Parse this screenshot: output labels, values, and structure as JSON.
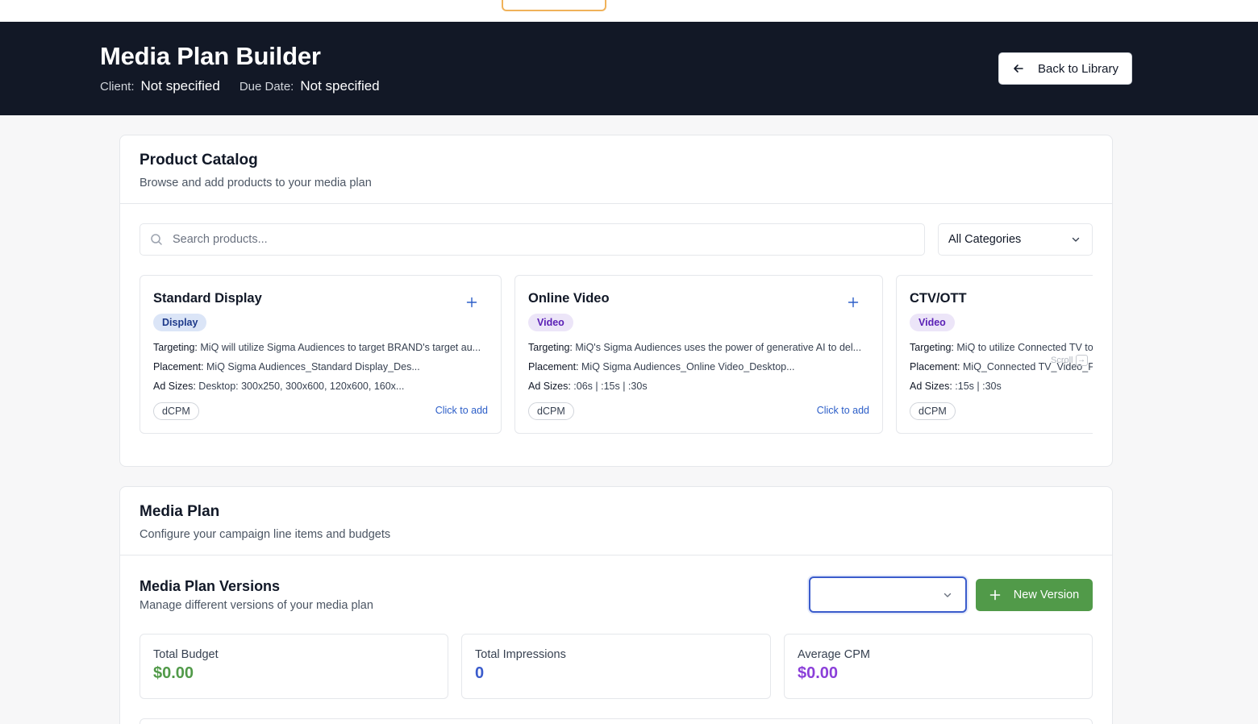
{
  "header": {
    "title": "Media Plan Builder",
    "client_label": "Client:",
    "client_value": "Not specified",
    "due_label": "Due Date:",
    "due_value": "Not specified",
    "back_label": "Back to Library"
  },
  "catalog": {
    "title": "Product Catalog",
    "subtitle": "Browse and add products to your media plan",
    "search_placeholder": "Search products...",
    "category_selected": "All Categories",
    "scroll_hint": "Scroll",
    "targeting_label": "Targeting:",
    "placement_label": "Placement:",
    "adsizes_label": "Ad Sizes:",
    "click_to_add": "Click to add",
    "products": [
      {
        "name": "Standard Display",
        "category": "Display",
        "targeting": "MiQ will utilize Sigma Audiences to target BRAND's target au...",
        "placement": "MiQ Sigma Audiences_Standard Display_Des...",
        "ad_sizes": "Desktop: 300x250, 300x600, 120x600, 160x...",
        "pricing": "dCPM"
      },
      {
        "name": "Online Video",
        "category": "Video",
        "targeting": "MiQ's Sigma Audiences uses the power of generative AI to del...",
        "placement": "MiQ Sigma Audiences_Online Video_Desktop...",
        "ad_sizes": ":06s | :15s | :30s",
        "pricing": "dCPM"
      },
      {
        "name": "CTV/OTT",
        "category": "Video",
        "targeting": "MiQ to utilize Connected TV to target BRAND's audience",
        "placement": "MiQ_Connected TV_Video_Placement",
        "ad_sizes": ":15s | :30s",
        "pricing": "dCPM"
      }
    ]
  },
  "media_plan": {
    "title": "Media Plan",
    "subtitle": "Configure your campaign line items and budgets",
    "versions_title": "Media Plan Versions",
    "versions_subtitle": "Manage different versions of your media plan",
    "version_selected": "",
    "new_version_label": "New Version",
    "stats": [
      {
        "label": "Total Budget",
        "value": "$0.00",
        "color": "#519a49"
      },
      {
        "label": "Total Impressions",
        "value": "0",
        "color": "#3b5ccc"
      },
      {
        "label": "Average CPM",
        "value": "$0.00",
        "color": "#8b3fd9"
      }
    ]
  },
  "colors": {
    "header_bg": "#121826",
    "accent_green": "#519a49",
    "accent_blue": "#3b5ccc",
    "link_blue": "#2c5ec8",
    "tab_indicator": "#f0b25a"
  }
}
